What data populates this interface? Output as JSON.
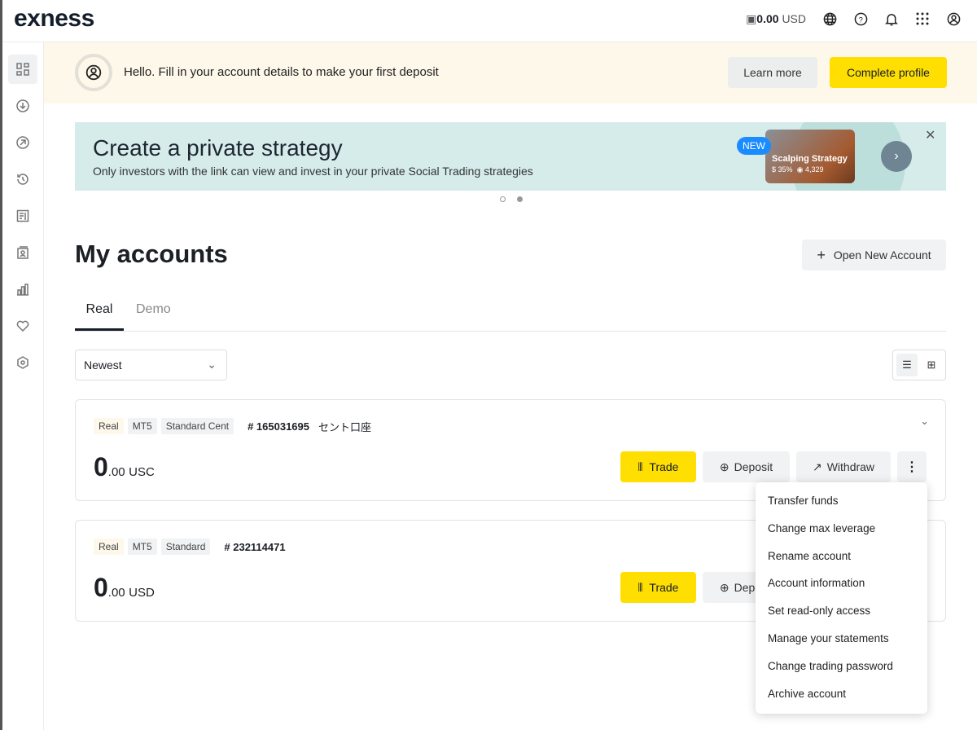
{
  "header": {
    "logo": "exness",
    "balance_amount": "0.00",
    "balance_currency": "USD"
  },
  "sidebar": {
    "items": [
      "dashboard-icon",
      "deposit-icon",
      "withdraw-icon",
      "history-icon",
      "analytics-icon",
      "contacts-icon",
      "performance-icon",
      "favorites-icon",
      "settings-icon"
    ]
  },
  "notice": {
    "text": "Hello. Fill in your account details to make your first deposit",
    "learn_more": "Learn more",
    "complete_profile": "Complete profile"
  },
  "promo": {
    "title": "Create a private strategy",
    "subtitle": "Only investors with the link can view and invest in your private Social Trading strategies",
    "badge": "NEW",
    "card_title": "Scalping Strategy",
    "card_return": "35%",
    "card_investors": "4,329",
    "slides_total": 2,
    "slide_active": 2
  },
  "main": {
    "title": "My accounts",
    "open_new": "Open New Account",
    "tabs": [
      {
        "label": "Real",
        "active": true
      },
      {
        "label": "Demo",
        "active": false
      }
    ],
    "sort": "Newest"
  },
  "accounts": [
    {
      "tags": [
        "Real",
        "MT5",
        "Standard Cent"
      ],
      "number": "# 165031695",
      "nickname": "セント口座",
      "balance_int": "0",
      "balance_dec": ".00",
      "currency": "USC",
      "trade": "Trade",
      "deposit": "Deposit",
      "withdraw": "Withdraw"
    },
    {
      "tags": [
        "Real",
        "MT5",
        "Standard"
      ],
      "number": "# 232114471",
      "nickname": "",
      "balance_int": "0",
      "balance_dec": ".00",
      "currency": "USD",
      "trade": "Trade",
      "deposit": "Deposit"
    }
  ],
  "menu": [
    "Transfer funds",
    "Change max leverage",
    "Rename account",
    "Account information",
    "Set read-only access",
    "Manage your statements",
    "Change trading password",
    "Archive account"
  ],
  "colors": {
    "accent": "#ffde02",
    "notice_bg": "#fdf8ea",
    "promo_bg": "#d6eceb",
    "new_badge": "#1a8cff"
  }
}
